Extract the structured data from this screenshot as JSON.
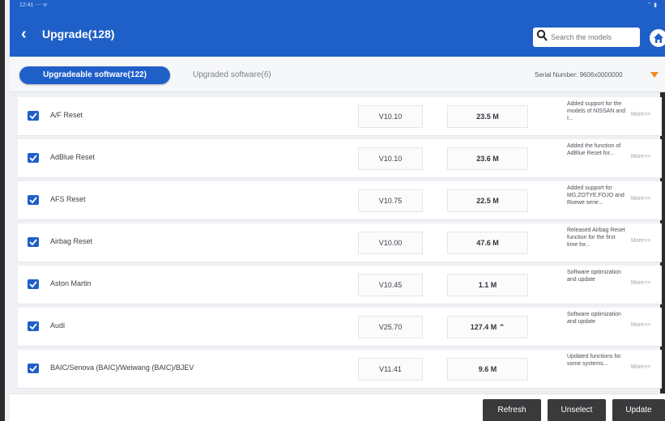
{
  "statusbar": {
    "left": "12:41 ⋯ ᯤ",
    "right": "⌔ ▮"
  },
  "header": {
    "title": "Upgrade(128)",
    "search_placeholder": "Search the models"
  },
  "tabs": {
    "active_label": "Upgradeable software(122)",
    "inactive_label": "Upgraded software(6)"
  },
  "serial": {
    "label": "Serial Number: 9606x0000000"
  },
  "rows": [
    {
      "name": "A/F Reset",
      "version": "V10.10",
      "size": "23.5 M",
      "desc": "Added support for the models of NISSAN and I...",
      "more": "More>>"
    },
    {
      "name": "AdBlue Reset",
      "version": "V10.10",
      "size": "23.6 M",
      "desc": "Added the function of AdBlue Reset for...",
      "more": "More>>"
    },
    {
      "name": "AFS Reset",
      "version": "V10.75",
      "size": "22.5 M",
      "desc": "Added support for MG,ZOTYE,FOJO and Roewe serie...",
      "more": "More>>"
    },
    {
      "name": "Airbag Reset",
      "version": "V10.00",
      "size": "47.6 M",
      "desc": "Released Airbag Reset function for the first time for...",
      "more": "More>>"
    },
    {
      "name": "Aston Martin",
      "version": "V10.45",
      "size": "1.1 M",
      "desc": "Software optimization and update",
      "more": "More>>"
    },
    {
      "name": "Audi",
      "version": "V25.70",
      "size": "127.4 M ⌃",
      "desc": "Software optimization and update",
      "more": "More>>"
    },
    {
      "name": "BAIC/Senova (BAIC)/Weiwang (BAIC)/BJEV",
      "version": "V11.41",
      "size": "9.6 M",
      "desc": "Updated functions for some systems...",
      "more": "More>>"
    }
  ],
  "footer": {
    "refresh": "Refresh",
    "unselect": "Unselect",
    "update": "Update"
  },
  "colors": {
    "brand": "#1f5fc8",
    "accent": "#f08a1c",
    "button": "#3a3a3d"
  }
}
